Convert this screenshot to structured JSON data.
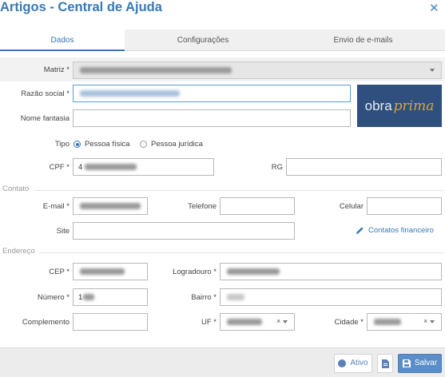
{
  "dialog": {
    "title": "Artigos - Central de Ajuda",
    "close_label": "✕"
  },
  "tabs": [
    {
      "label": "Dados",
      "active": true
    },
    {
      "label": "Configurações",
      "active": false
    },
    {
      "label": "Envio de e-mails",
      "active": false
    }
  ],
  "form": {
    "matriz_label": "Matriz *",
    "razao_social_label": "Razão social *",
    "nome_fantasia_label": "Nome fantasia",
    "tipo_label": "Tipo",
    "tipo_options": [
      "Pessoa física",
      "Pessoa jurídica"
    ],
    "tipo_selected": "Pessoa física",
    "cpf_label": "CPF *",
    "cpf_value_prefix": "4",
    "rg_label": "RG"
  },
  "logo": {
    "part1": "obra",
    "part2": "prima"
  },
  "contato": {
    "section_title": "Contato",
    "email_label": "E-mail *",
    "telefone_label": "Telefone",
    "celular_label": "Celular",
    "site_label": "Site",
    "contatos_link": "Contatos financeiro"
  },
  "endereco": {
    "section_title": "Endereço",
    "cep_label": "CEP *",
    "logradouro_label": "Logradouro *",
    "numero_label": "Número *",
    "numero_value_prefix": "1",
    "bairro_label": "Bairro *",
    "complemento_label": "Complemento",
    "uf_label": "UF *",
    "cidade_label": "Cidade *",
    "clear_symbol": "×"
  },
  "footer": {
    "ativo_label": "Ativo",
    "salvar_label": "Salvar"
  },
  "colors": {
    "accent": "#3a78b5",
    "salvar_bg": "#5b8ec9",
    "logo_bg": "#2f4f7f",
    "logo_accent": "#d9a441"
  }
}
